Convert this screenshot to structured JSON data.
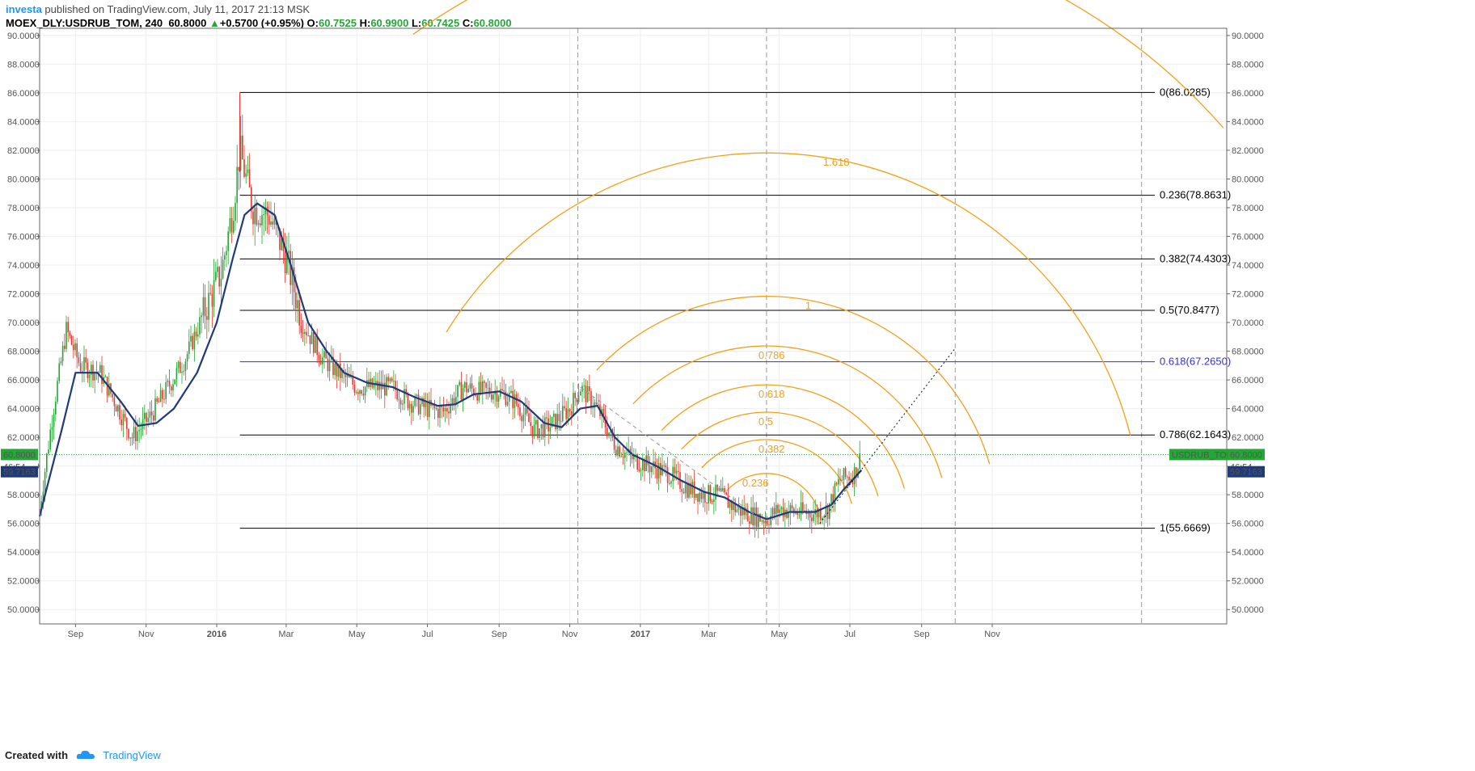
{
  "header": {
    "user": "investa",
    "published_text": " published on TradingView.com, July 11, 2017 21:13 MSK",
    "symbol_line": "MOEX_DLY:USDRUB_TOM, 240",
    "last": "60.8000",
    "change": "+0.5700 (+0.95%)",
    "o_label": "O:",
    "o_val": "60.7525",
    "h_label": "H:",
    "h_val": "60.9900",
    "l_label": "L:",
    "l_val": "60.7425",
    "c_label": "C:",
    "c_val": "60.8000",
    "up_arrow": "▲"
  },
  "footer": {
    "created": "Created with",
    "brand": "TradingView",
    "logo_icon": "tradingview-cloud-icon"
  },
  "colors": {
    "up": "#26a637",
    "down": "#e53935",
    "ma": "#1f3a7a",
    "fib": "#000000",
    "fib_618": "#3333cc",
    "arc": "#f3a01b",
    "badge_green": "#26a637",
    "badge_navy": "#1f3a7a"
  },
  "chart_data": {
    "type": "candlestick",
    "title": "",
    "ylim": [
      49,
      90.5
    ],
    "y_ticks": [
      "90.0000",
      "88.0000",
      "86.0000",
      "84.0000",
      "82.0000",
      "80.0000",
      "78.0000",
      "76.0000",
      "74.0000",
      "72.0000",
      "70.0000",
      "68.0000",
      "66.0000",
      "64.0000",
      "62.0000",
      "60.0000",
      "58.0000",
      "56.0000",
      "54.0000",
      "52.0000",
      "50.0000"
    ],
    "x_labels": [
      {
        "t": "2015-09",
        "label": "Sep",
        "bold": false
      },
      {
        "t": "2015-11",
        "label": "Nov",
        "bold": false
      },
      {
        "t": "2016-01",
        "label": "2016",
        "bold": true
      },
      {
        "t": "2016-03",
        "label": "Mar",
        "bold": false
      },
      {
        "t": "2016-05",
        "label": "May",
        "bold": false
      },
      {
        "t": "2016-07",
        "label": "Jul",
        "bold": false
      },
      {
        "t": "2016-09",
        "label": "Sep",
        "bold": false
      },
      {
        "t": "2016-11",
        "label": "Nov",
        "bold": false
      },
      {
        "t": "2017-01",
        "label": "2017",
        "bold": true
      },
      {
        "t": "2017-03",
        "label": "Mar",
        "bold": false
      },
      {
        "t": "2017-05",
        "label": "May",
        "bold": false
      },
      {
        "t": "2017-07",
        "label": "Jul",
        "bold": false
      },
      {
        "t": "2017-09",
        "label": "Sep",
        "bold": false
      },
      {
        "t": "2017-11",
        "label": "Nov",
        "bold": false
      }
    ],
    "price_path": [
      {
        "t": "2015-08-01",
        "v": 57.0
      },
      {
        "t": "2015-08-12",
        "v": 63.5
      },
      {
        "t": "2015-08-24",
        "v": 69.5
      },
      {
        "t": "2015-09-05",
        "v": 67.0
      },
      {
        "t": "2015-09-22",
        "v": 66.5
      },
      {
        "t": "2015-10-05",
        "v": 64.5
      },
      {
        "t": "2015-10-20",
        "v": 62.0
      },
      {
        "t": "2015-11-05",
        "v": 63.5
      },
      {
        "t": "2015-11-20",
        "v": 65.5
      },
      {
        "t": "2015-12-05",
        "v": 67.5
      },
      {
        "t": "2015-12-20",
        "v": 70.5
      },
      {
        "t": "2016-01-05",
        "v": 73.5
      },
      {
        "t": "2016-01-15",
        "v": 78.0
      },
      {
        "t": "2016-01-21",
        "v": 82.0
      },
      {
        "t": "2016-02-01",
        "v": 78.0
      },
      {
        "t": "2016-02-15",
        "v": 77.5
      },
      {
        "t": "2016-03-01",
        "v": 74.5
      },
      {
        "t": "2016-03-15",
        "v": 70.0
      },
      {
        "t": "2016-04-01",
        "v": 67.5
      },
      {
        "t": "2016-04-15",
        "v": 66.5
      },
      {
        "t": "2016-05-01",
        "v": 65.5
      },
      {
        "t": "2016-05-15",
        "v": 65.5
      },
      {
        "t": "2016-06-01",
        "v": 65.5
      },
      {
        "t": "2016-06-15",
        "v": 64.5
      },
      {
        "t": "2016-07-01",
        "v": 64.0
      },
      {
        "t": "2016-07-15",
        "v": 63.8
      },
      {
        "t": "2016-08-01",
        "v": 65.5
      },
      {
        "t": "2016-08-15",
        "v": 65.2
      },
      {
        "t": "2016-09-01",
        "v": 65.2
      },
      {
        "t": "2016-09-15",
        "v": 64.5
      },
      {
        "t": "2016-10-01",
        "v": 62.5
      },
      {
        "t": "2016-10-15",
        "v": 62.8
      },
      {
        "t": "2016-11-01",
        "v": 64.0
      },
      {
        "t": "2016-11-10",
        "v": 65.5
      },
      {
        "t": "2016-11-25",
        "v": 64.0
      },
      {
        "t": "2016-12-10",
        "v": 61.5
      },
      {
        "t": "2016-12-25",
        "v": 60.5
      },
      {
        "t": "2017-01-10",
        "v": 60.0
      },
      {
        "t": "2017-01-25",
        "v": 59.5
      },
      {
        "t": "2017-02-10",
        "v": 58.5
      },
      {
        "t": "2017-02-25",
        "v": 58.0
      },
      {
        "t": "2017-03-10",
        "v": 58.0
      },
      {
        "t": "2017-03-25",
        "v": 57.0
      },
      {
        "t": "2017-04-10",
        "v": 56.5
      },
      {
        "t": "2017-04-20",
        "v": 56.3
      },
      {
        "t": "2017-05-01",
        "v": 57.0
      },
      {
        "t": "2017-05-15",
        "v": 56.8
      },
      {
        "t": "2017-06-01",
        "v": 56.7
      },
      {
        "t": "2017-06-12",
        "v": 57.0
      },
      {
        "t": "2017-06-22",
        "v": 59.0
      },
      {
        "t": "2017-07-05",
        "v": 59.5
      },
      {
        "t": "2017-07-11",
        "v": 60.8
      }
    ],
    "ma_path": [
      {
        "t": "2015-08-01",
        "v": 56.5
      },
      {
        "t": "2015-08-20",
        "v": 62.5
      },
      {
        "t": "2015-09-01",
        "v": 66.5
      },
      {
        "t": "2015-09-20",
        "v": 66.5
      },
      {
        "t": "2015-10-10",
        "v": 64.5
      },
      {
        "t": "2015-10-25",
        "v": 62.8
      },
      {
        "t": "2015-11-10",
        "v": 63.0
      },
      {
        "t": "2015-11-25",
        "v": 64.0
      },
      {
        "t": "2015-12-15",
        "v": 66.5
      },
      {
        "t": "2016-01-01",
        "v": 70.0
      },
      {
        "t": "2016-01-15",
        "v": 74.5
      },
      {
        "t": "2016-01-25",
        "v": 77.5
      },
      {
        "t": "2016-02-05",
        "v": 78.3
      },
      {
        "t": "2016-02-20",
        "v": 77.5
      },
      {
        "t": "2016-03-05",
        "v": 74.0
      },
      {
        "t": "2016-03-20",
        "v": 70.0
      },
      {
        "t": "2016-04-05",
        "v": 68.0
      },
      {
        "t": "2016-04-20",
        "v": 66.5
      },
      {
        "t": "2016-05-10",
        "v": 65.8
      },
      {
        "t": "2016-06-01",
        "v": 65.5
      },
      {
        "t": "2016-06-20",
        "v": 64.8
      },
      {
        "t": "2016-07-10",
        "v": 64.2
      },
      {
        "t": "2016-07-25",
        "v": 64.3
      },
      {
        "t": "2016-08-10",
        "v": 65.0
      },
      {
        "t": "2016-09-01",
        "v": 65.2
      },
      {
        "t": "2016-09-20",
        "v": 64.5
      },
      {
        "t": "2016-10-10",
        "v": 63.0
      },
      {
        "t": "2016-10-25",
        "v": 62.7
      },
      {
        "t": "2016-11-10",
        "v": 64.0
      },
      {
        "t": "2016-11-25",
        "v": 64.2
      },
      {
        "t": "2016-12-10",
        "v": 62.0
      },
      {
        "t": "2016-12-25",
        "v": 60.8
      },
      {
        "t": "2017-01-15",
        "v": 60.0
      },
      {
        "t": "2017-02-05",
        "v": 59.0
      },
      {
        "t": "2017-02-25",
        "v": 58.2
      },
      {
        "t": "2017-03-15",
        "v": 57.8
      },
      {
        "t": "2017-04-05",
        "v": 56.8
      },
      {
        "t": "2017-04-20",
        "v": 56.3
      },
      {
        "t": "2017-05-10",
        "v": 56.8
      },
      {
        "t": "2017-06-01",
        "v": 56.8
      },
      {
        "t": "2017-06-15",
        "v": 57.3
      },
      {
        "t": "2017-06-25",
        "v": 58.3
      },
      {
        "t": "2017-07-11",
        "v": 59.7163
      }
    ],
    "fib_retracement": {
      "start": "2016-01-21",
      "end": "2018-01-01",
      "levels": [
        {
          "ratio": "0",
          "value": 86.0285,
          "label": "0(86.0285)"
        },
        {
          "ratio": "0.236",
          "value": 78.8631,
          "label": "0.236(78.8631)"
        },
        {
          "ratio": "0.382",
          "value": 74.4303,
          "label": "0.382(74.4303)"
        },
        {
          "ratio": "0.5",
          "value": 70.8477,
          "label": "0.5(70.8477)"
        },
        {
          "ratio": "0.618",
          "value": 67.265,
          "label": "0.618(67.2650)"
        },
        {
          "ratio": "0.786",
          "value": 62.1643,
          "label": "0.786(62.1643)"
        },
        {
          "ratio": "1",
          "value": 55.6669,
          "label": "1(55.6669)"
        }
      ]
    },
    "fib_arcs": {
      "center": {
        "t": "2017-04-20",
        "v": 55.6669
      },
      "ratios": [
        {
          "ratio": 0.236,
          "label": "0.236"
        },
        {
          "ratio": 0.382,
          "label": "0.382"
        },
        {
          "ratio": 0.5,
          "label": "0.5"
        },
        {
          "ratio": 0.618,
          "label": "0.618"
        },
        {
          "ratio": 0.786,
          "label": "0.786"
        },
        {
          "ratio": 1,
          "label": "1"
        },
        {
          "ratio": 1.618,
          "label": "1.618"
        },
        {
          "ratio": 2.618,
          "label": ""
        }
      ]
    },
    "time_zones": [
      "2016-11-08",
      "2017-04-20",
      "2017-09-30",
      "2018-03-10",
      "2018-08-20"
    ],
    "trendline_dashed": [
      {
        "t": "2016-11-10",
        "v": 65.5
      },
      {
        "t": "2017-04-20",
        "v": 56.0
      }
    ],
    "trendline_dotted": [
      {
        "t": "2017-06-05",
        "v": 56.0
      },
      {
        "t": "2017-09-30",
        "v": 68.2
      }
    ],
    "last_price_line": 60.8,
    "price_labels": {
      "left_last": "60.8000",
      "left_time": "46:54",
      "left_ma": "59.7163",
      "right_name": "USDRUB_TOM",
      "right_last": "60.8000",
      "right_time": "46:54",
      "right_ma": "59.7163"
    }
  }
}
